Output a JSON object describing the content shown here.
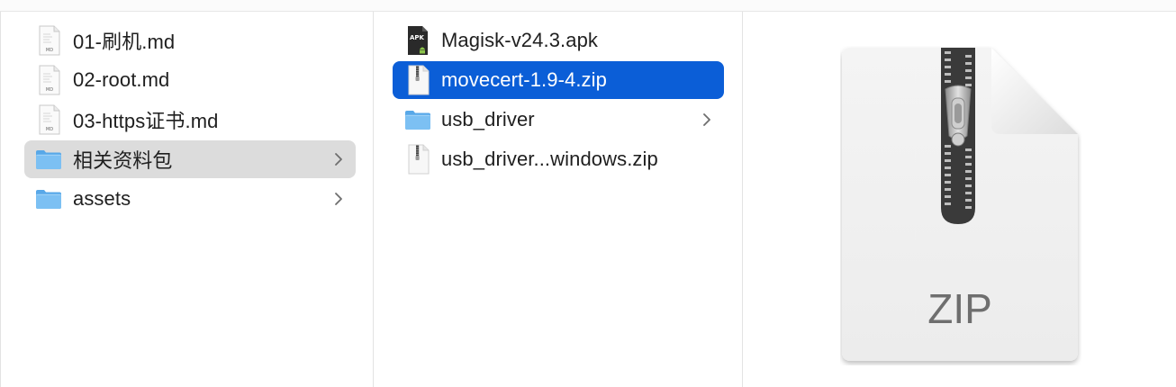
{
  "colors": {
    "selection": "#0b5ed7",
    "hover": "#dcdcdc",
    "folder": "#6cb4ef",
    "separator": "#e3e3e3"
  },
  "column1": {
    "items": [
      {
        "label": "01-刷机.md",
        "icon": "markdown-file-icon"
      },
      {
        "label": "02-root.md",
        "icon": "markdown-file-icon"
      },
      {
        "label": "03-https证书.md",
        "icon": "markdown-file-icon"
      },
      {
        "label": "相关资料包",
        "icon": "folder-icon",
        "chevron": true,
        "state": "highlighted"
      },
      {
        "label": "assets",
        "icon": "folder-icon",
        "chevron": true
      }
    ]
  },
  "column2": {
    "items": [
      {
        "label": "Magisk-v24.3.apk",
        "icon": "apk-file-icon",
        "badge": "APK"
      },
      {
        "label": "movecert-1.9-4.zip",
        "icon": "zip-file-icon",
        "state": "selected"
      },
      {
        "label": "usb_driver",
        "icon": "folder-icon",
        "chevron": true
      },
      {
        "label": "usb_driver...windows.zip",
        "icon": "zip-file-icon"
      }
    ]
  },
  "preview": {
    "icon": "zip-archive-large-icon",
    "type_label": "ZIP"
  }
}
